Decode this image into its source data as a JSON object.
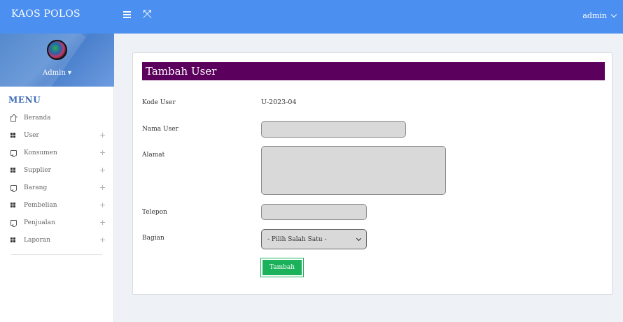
{
  "header": {
    "brand": "KAOS POLOS",
    "user": "admin"
  },
  "sidebar": {
    "profile_name": "Admin",
    "menu_title": "MENU",
    "items": [
      {
        "label": "Beranda",
        "icon": "home-icon",
        "expandable": false
      },
      {
        "label": "User",
        "icon": "grid-icon",
        "expandable": true
      },
      {
        "label": "Konsumen",
        "icon": "chat-icon",
        "expandable": true
      },
      {
        "label": "Supplier",
        "icon": "grid-icon",
        "expandable": true
      },
      {
        "label": "Barang",
        "icon": "chat-icon",
        "expandable": true
      },
      {
        "label": "Pembelian",
        "icon": "grid-icon",
        "expandable": true
      },
      {
        "label": "Penjualan",
        "icon": "chat-icon",
        "expandable": true
      },
      {
        "label": "Laporan",
        "icon": "grid-icon",
        "expandable": true
      }
    ],
    "expand_symbol": "+"
  },
  "form": {
    "title": "Tambah User",
    "kode_user_label": "Kode User",
    "kode_user_value": "U-2023-04",
    "nama_user_label": "Nama User",
    "nama_user_value": "",
    "alamat_label": "Alamat",
    "alamat_value": "",
    "telepon_label": "Telepon",
    "telepon_value": "",
    "bagian_label": "Bagian",
    "bagian_selected": "- Pilih Salah Satu -",
    "submit_label": "Tambah"
  },
  "colors": {
    "topbar": "#4b8ff0",
    "card_header": "#5b005c",
    "submit_button": "#1cb25b",
    "menu_title": "#3f6db5"
  }
}
